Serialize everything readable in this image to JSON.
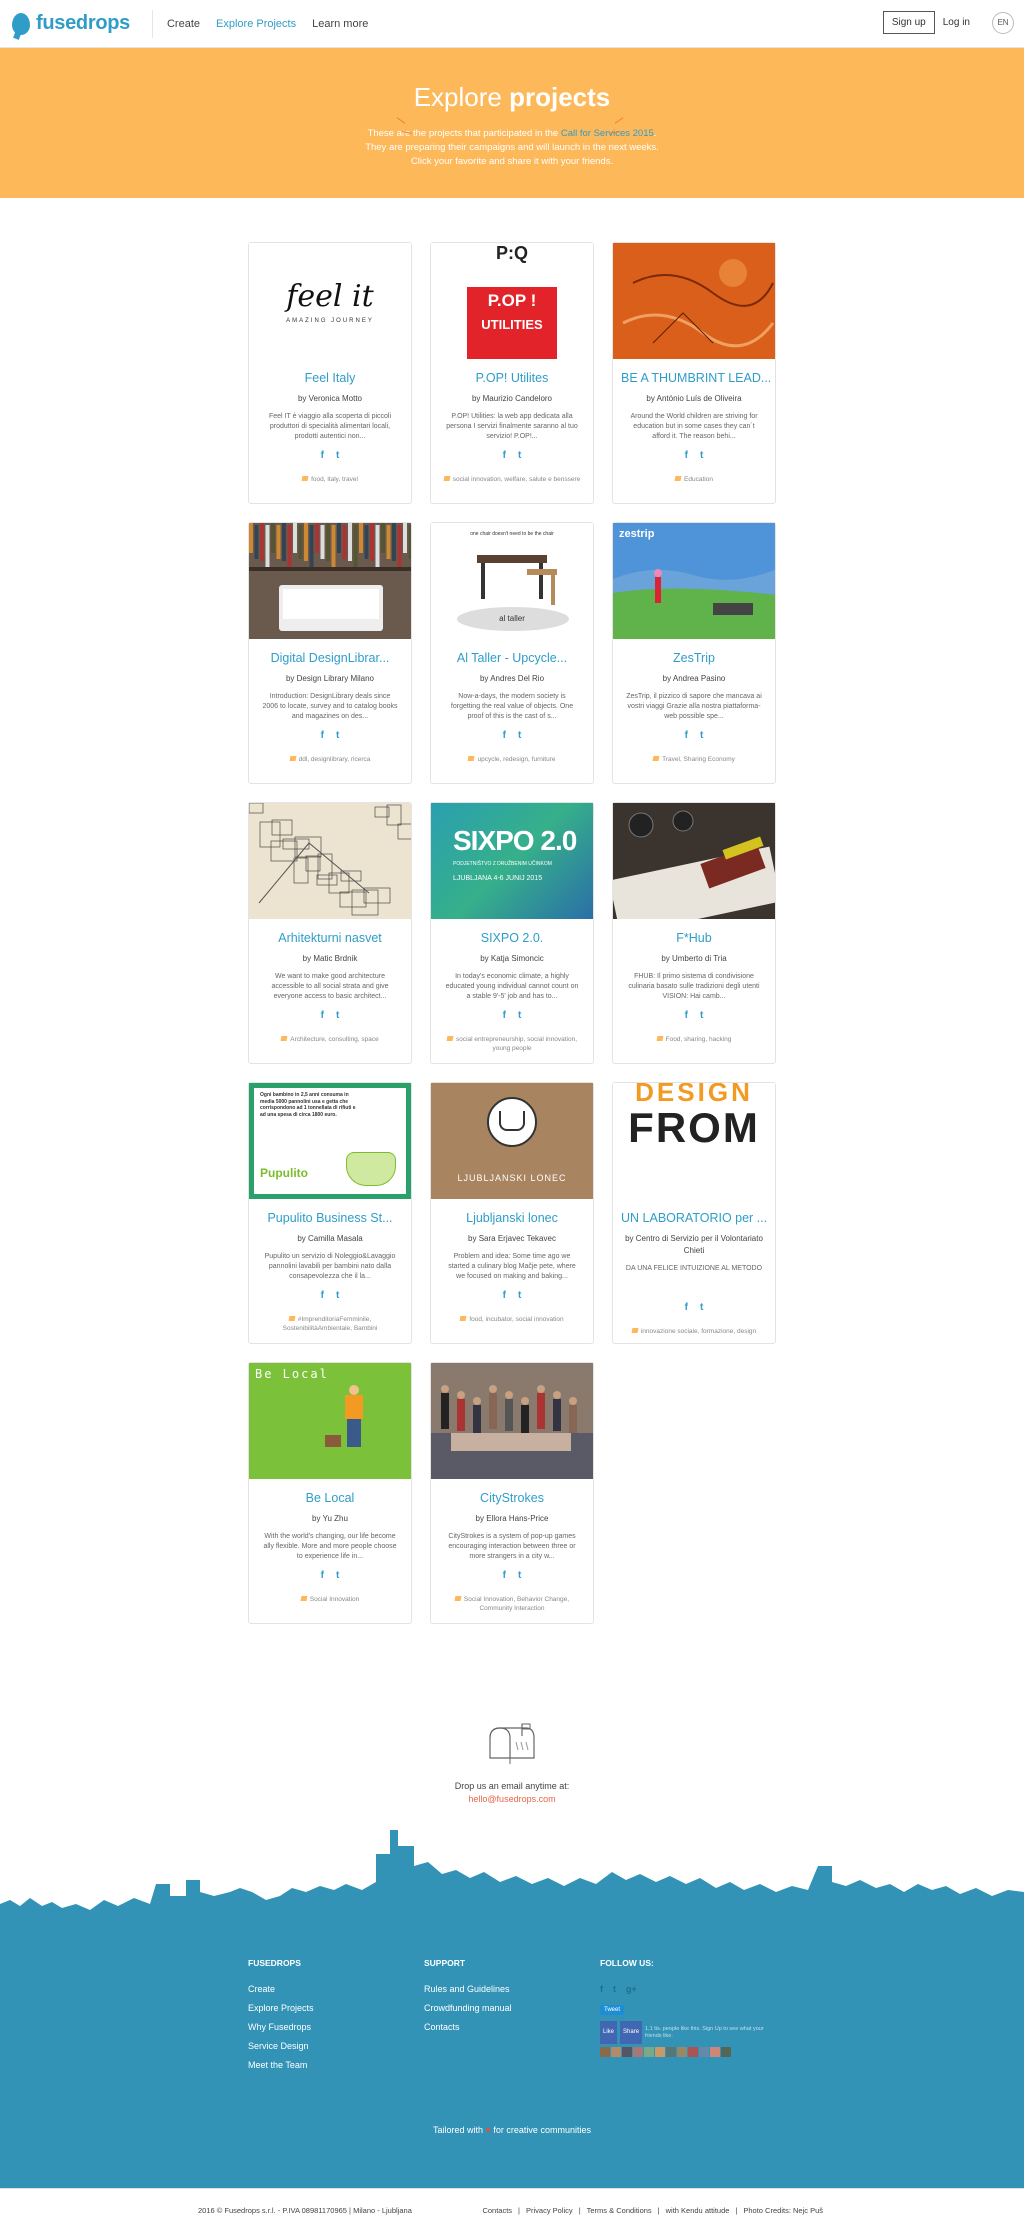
{
  "header": {
    "logo": "fusedrops",
    "nav": [
      "Create",
      "Explore Projects",
      "Learn more"
    ],
    "signup": "Sign up",
    "login": "Log in",
    "lang": "EN"
  },
  "hero": {
    "title_light": "Explore",
    "title_bold": "projects",
    "line1_a": "These are the projects that participated in the",
    "line1_link": "Call for Services 2015",
    "line1_b": ".",
    "line2": "They are preparing their campaigns and will launch in the next weeks.",
    "line3": "Click your favorite and share it with your friends."
  },
  "projects": [
    {
      "title": "Feel Italy",
      "author": "by Veronica Motto",
      "desc": "Feel IT è viaggio alla scoperta di piccoli produttori di specialità alimentari locali, prodotti autentici non...",
      "tags": "food, italy, travel",
      "thumb": "feelit",
      "thumb_text": "feel it",
      "thumb_sub": "AMAZING JOURNEY"
    },
    {
      "title": "P.OP! Utilites",
      "author": "by Maurizio Candeloro",
      "desc": "P.OP! Utilities: la web app dedicata alla persona I servizi finalmente saranno al tuo servizio! P.OP!...",
      "tags": "social innovation, welfare, salute e benssere",
      "thumb": "pop",
      "thumb_text": "P.OP !",
      "thumb_sub": "UTILITIES"
    },
    {
      "title": "BE A THUMBRINT LEAD...",
      "author": "by António Luís de Oliveira",
      "desc": "Around the World children are striving for education but in some cases they can´t afford it. The reason behi...",
      "tags": "Education",
      "thumb": "orange"
    },
    {
      "title": "Digital DesignLibrar...",
      "author": "by Design Library Milano",
      "desc": "Introduction: DesignLibrary deals since 2006 to locate, survey and to catalog books and magazines on des...",
      "tags": "ddl, designlibrary, ricerca",
      "thumb": "library"
    },
    {
      "title": "Al Taller - Upcycle...",
      "author": "by Andres Del Rio",
      "desc": "Now-a-days, the modern society is forgetting the real value of objects. One proof of this is the cast of s...",
      "tags": "upcycle, redesign, furniture",
      "thumb": "taller",
      "thumb_text": "al taller",
      "thumb_sub": "one chair doesn't need to be the chair"
    },
    {
      "title": "ZesTrip",
      "author": "by Andrea Pasino",
      "desc": "ZesTrip, il pizzico di sapore che mancava ai vostri viaggi Grazie alla nostra piattaforma-web possible spe...",
      "tags": "Travel, Sharing Economy",
      "thumb": "zestrip",
      "thumb_text": "zestrip"
    },
    {
      "title": "Arhitekturni nasvet",
      "author": "by Matic Brdnik",
      "desc": "We want to make good architecture accessible to all social strata and give everyone access to basic architect...",
      "tags": "Architecture, consulting, space",
      "thumb": "sketch"
    },
    {
      "title": "SIXPO 2.0.",
      "author": "by Katja Simoncic",
      "desc": "In today's economic climate, a highly educated young individual cannot count on a stable 9'-5' job and has to...",
      "tags": "social entrepreneurship, social innovation, young people",
      "thumb": "sixpo",
      "thumb_text": "SIXPO 2.0",
      "thumb_sub": "PODJETNIŠTVO Z DRUŽBENIM UČINKOM",
      "thumb_sub2": "LJUBLJANA  4-6 JUNIJ 2015"
    },
    {
      "title": "F*Hub",
      "author": "by Umberto di Tria",
      "desc": "FHUB: Il primo sistema di condivisione culinaria basato sulle tradizioni degli utenti VISION: Hai camb...",
      "tags": "Food, sharing, hacking",
      "thumb": "fhub"
    },
    {
      "title": "Pupulito Business St...",
      "author": "by Camilla Masala",
      "desc": "Pupulito un servizio di Noleggio&Lavaggio pannolini lavabili per bambini nato dalla consapevolezza che il la...",
      "tags": "#ImprenditoriaFemminile, SostenibilitàAmbientale, Bambini",
      "thumb": "pupulito",
      "thumb_text": "Ogni bambino in 2,5 anni consuma in media 5000 pannolini usa e getta che corrispondono ad 1 tonnellata di rifiuti e ad una spesa di circa 1800 euro.",
      "thumb_sub": "Pupulito"
    },
    {
      "title": "Ljubljanski lonec",
      "author": "by Sara Erjavec Tekavec",
      "desc": "Problem and idea: Some time ago we started a culinary blog Mačje pete, where we focused on making and baking...",
      "tags": "food, incubator, social innovation",
      "thumb": "lonec",
      "thumb_text": "LJUBLJANSKI LONEC"
    },
    {
      "title": "UN LABORATORIO per ...",
      "author": "by Centro di Servizio per il Volontariato Chieti",
      "desc": "DA UNA FELICE INTUIZIONE AL METODO",
      "tags": "innovazione sociale, formazione, design",
      "thumb": "design",
      "thumb_text": "DESIGN",
      "thumb_sub": "FROM"
    },
    {
      "title": "Be Local",
      "author": "by Yu Zhu",
      "desc": "With the world's changing, our life become ally flexible. More and more people choose to experience life in...",
      "tags": "Social Innovation",
      "thumb": "belocal",
      "thumb_text": "Be Local"
    },
    {
      "title": "CityStrokes",
      "author": "by Ellora Hans-Price",
      "desc": "CityStrokes is a system of pop-up games encouraging interaction between three or more strangers in a city w...",
      "tags": "Social Innovation, Behavior Change, Community Interaction",
      "thumb": "street"
    }
  ],
  "mail": {
    "line": "Drop us an email anytime at:",
    "email": "hello@fusedrops.com"
  },
  "footer": {
    "col1": {
      "title": "FUSEDROPS",
      "items": [
        "Create",
        "Explore Projects",
        "Why Fusedrops",
        "Service Design",
        "Meet the Team"
      ]
    },
    "col2": {
      "title": "SUPPORT",
      "items": [
        "Rules and Guidelines",
        "Crowdfunding manual",
        "Contacts"
      ]
    },
    "col3": {
      "title": "FOLLOW US:",
      "tweet": "Tweet",
      "like": "Like",
      "share": "Share",
      "fb_text": "1,1 tis. people like this. Sign Up to see what your friends like."
    },
    "tailored_a": "Tailored with",
    "tailored_b": "for creative communities",
    "copyright": "2016 © Fusedrops s.r.l. - P.IVA 08981170965  |  Milano - Ljubljana",
    "links": [
      "Contacts",
      "Privacy Policy",
      "Terms & Conditions",
      "with Kendu attitude",
      "Photo Credits: Nejc Puš"
    ]
  },
  "colors": {
    "brand": "#2f9dc8",
    "hero": "#fdb85a",
    "footer": "#3293b7"
  }
}
